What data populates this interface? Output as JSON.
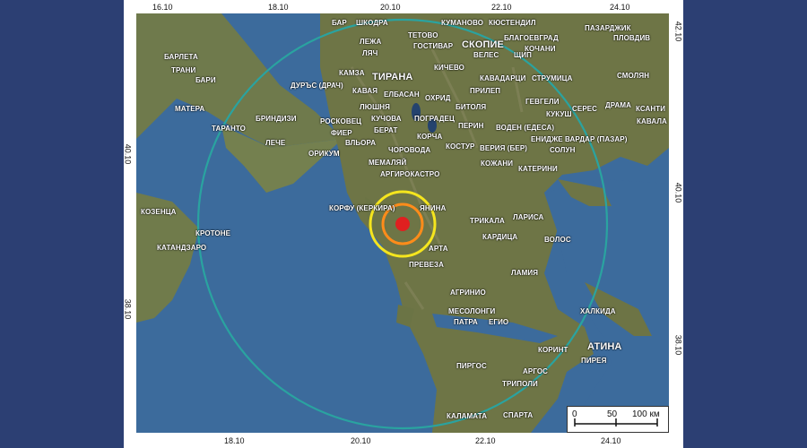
{
  "map": {
    "top_ticks": [
      "16.10",
      "18.10",
      "20.10",
      "22.10",
      "24.10"
    ],
    "bottom_ticks": [
      "18.10",
      "20.10",
      "22.10",
      "24.10"
    ],
    "left_ticks": [
      "40.10",
      "38.10"
    ],
    "right_ticks": [
      "42.10",
      "40.10",
      "38.10"
    ],
    "epicenter_color": "#e02020",
    "ring_colors": {
      "inner": "#ff8c1a",
      "middle": "#f5e51e",
      "outer": "#2aa3a0"
    },
    "labels": {
      "bar": "БАР",
      "shkodra": "ШКОДРА",
      "kumanovo": "КУМАНОВО",
      "kyustendil": "КЮСТЕНДИЛ",
      "pazardzhik": "ПАЗАРДЖИК",
      "tetovo": "ТЕТОВО",
      "gostivar": "ГОСТИВАР",
      "skopie": "СКОПИЕ",
      "blagoevgrad": "БЛАГОЕВГРАД",
      "plovdiv": "ПЛОВДИВ",
      "lezha": "ЛЕЖА",
      "lyach": "ЛЯЧ",
      "veles": "ВЕЛЕС",
      "shtip": "ЩИП",
      "kochani": "КОЧАНИ",
      "barletta": "БАРЛЕТА",
      "trani": "ТРАНИ",
      "bari": "БАРИ",
      "kamza": "КАМЗА",
      "tirana": "ТИРАНА",
      "kichevo": "КИЧЕВО",
      "smolyan": "СМОЛЯН",
      "durres": "ДУРЪС (ДРАЧ)",
      "kavadartsi": "КАВАДАРЦИ",
      "strumitsa": "СТРУМИЦА",
      "kavaya": "КАВАЯ",
      "elbasan": "ЕЛБАСАН",
      "ohrid": "ОХРИД",
      "prilep": "ПРИЛЕП",
      "matera": "МАТЕРА",
      "lyushnya": "ЛЮШНЯ",
      "bitolya": "БИТОЛЯ",
      "gevgeli": "ГЕВГЕЛИ",
      "seres": "СЕРЕС",
      "drama": "ДРАМА",
      "ksanti": "КСАНТИ",
      "brindisi": "БРИНДИЗИ",
      "kuchova": "КУЧОВА",
      "pogradets": "ПОГРАДЕЦ",
      "kukush": "КУКУШ",
      "kavala": "КАВАЛА",
      "taranto": "ТАРАНТО",
      "roskovets": "РОСКОВЕЦ",
      "perin": "ПЕРИН",
      "voden": "ВОДЕН (ЕДЕСА)",
      "fier": "ФИЕР",
      "berat": "БЕРАТ",
      "korcha": "КОРЧА",
      "enidzhe": "ЕНИДЖЕ ВАРДАР (ПАЗАР)",
      "leche": "ЛЕЧЕ",
      "vlora": "ВЛЬОРА",
      "kostur": "КОСТУР",
      "veria": "ВЕРИЯ (БЕР)",
      "solun": "СОЛУН",
      "orikum": "ОРИКУМ",
      "chorovoda": "ЧОРОВОДА",
      "memalyay": "МЕМАЛЯЙ",
      "kozhani": "КОЖАНИ",
      "katerini": "КАТЕРИНИ",
      "argirokastro": "АРГИРОКАСТРО",
      "kozentsa": "КОЗЕНЦА",
      "korfu": "КОРФУ (КЕРКИРА)",
      "yanina": "ЯНИНА",
      "trikala": "ТРИКАЛА",
      "larisa": "ЛАРИСА",
      "krotone": "КРОТОНЕ",
      "kardiza": "КАРДИЦА",
      "volos": "ВОЛОС",
      "katandzaro": "КАТАНДЗАРО",
      "arta": "АРТА",
      "preveza": "ПРЕВЕЗА",
      "lamia": "ЛАМИЯ",
      "agrinio": "АГРИНИО",
      "mesolongi": "МЕСОЛОНГИ",
      "halkida": "ХАЛКИДА",
      "patra": "ПАТРА",
      "egio": "ЕГИО",
      "korint": "КОРИНТ",
      "atina": "АТИНА",
      "pirea": "ПИРЕЯ",
      "pirgos": "ПИРГОС",
      "argos": "АРГОС",
      "tripoli": "ТРИПОЛИ",
      "kalamata": "КАЛАМАТА",
      "sparta": "СПАРТА"
    },
    "scalebar": {
      "zero": "0",
      "mid": "50",
      "end": "100 км"
    }
  }
}
